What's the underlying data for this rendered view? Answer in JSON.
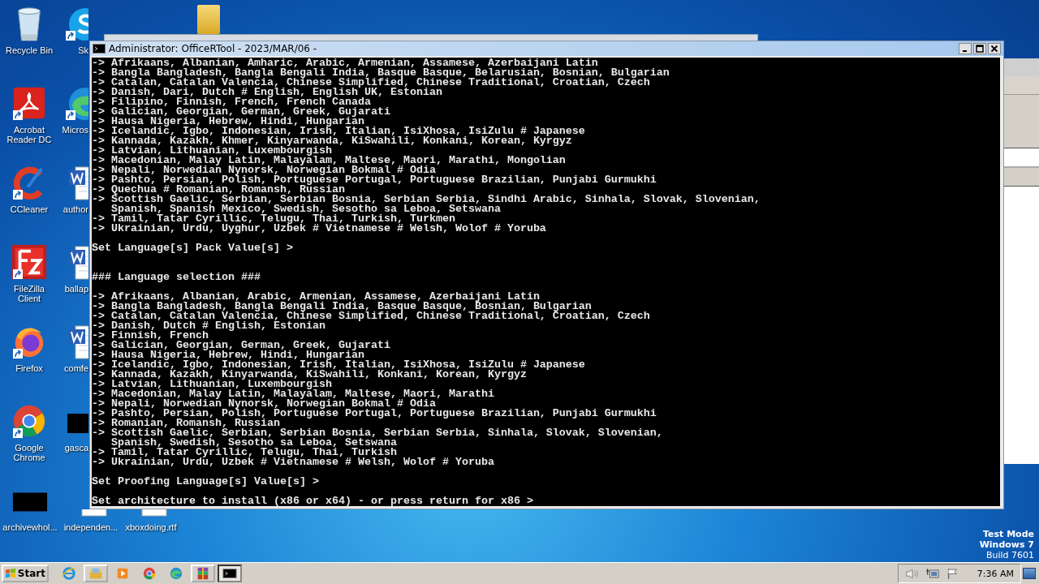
{
  "desktop_icons": [
    {
      "kind": "recycle-bin",
      "label": "Recycle Bin"
    },
    {
      "kind": "skype",
      "label": "Sk"
    },
    {
      "kind": "pdf",
      "label": "Acrobat Reader DC"
    },
    {
      "kind": "edge",
      "label": "Micros"
    },
    {
      "kind": "ccleaner",
      "label": "CCleaner"
    },
    {
      "kind": "word",
      "label": "author"
    },
    {
      "kind": "filezilla",
      "label": "FileZilla Client"
    },
    {
      "kind": "word",
      "label": "ballap"
    },
    {
      "kind": "firefox",
      "label": "Firefox"
    },
    {
      "kind": "word",
      "label": "comfe"
    },
    {
      "kind": "chrome",
      "label": "Google Chrome"
    },
    {
      "kind": "blank",
      "label": "gasca"
    },
    {
      "kind": "blank",
      "label": "archivewhol..."
    },
    {
      "kind": "word",
      "label": "independen..."
    },
    {
      "kind": "word",
      "label": "xboxdoing.rtf"
    }
  ],
  "console": {
    "title": "Administrator: OfficeRTool - 2023/MAR/06 -",
    "blocks": [
      {
        "kind": "list",
        "lines": [
          "-> Afrikaans, Albanian, Amharic, Arabic, Armenian, Assamese, Azerbaijani Latin",
          "-> Bangla Bangladesh, Bangla Bengali India, Basque Basque, Belarusian, Bosnian, Bulgarian",
          "-> Catalan, Catalan Valencia, Chinese Simplified, Chinese Traditional, Croatian, Czech",
          "-> Danish, Dari, Dutch # English, English UK, Estonian",
          "-> Filipino, Finnish, French, French Canada",
          "-> Galician, Georgian, German, Greek, Gujarati",
          "-> Hausa Nigeria, Hebrew, Hindi, Hungarian",
          "-> Icelandic, Igbo, Indonesian, Irish, Italian, IsiXhosa, IsiZulu # Japanese",
          "-> Kannada, Kazakh, Khmer, Kinyarwanda, KiSwahili, Konkani, Korean, Kyrgyz",
          "-> Latvian, Lithuanian, Luxembourgish",
          "-> Macedonian, Malay Latin, Malayalam, Maltese, Maori, Marathi, Mongolian",
          "-> Nepali, Norwedian Nynorsk, Norwegian Bokmal # Odia",
          "-> Pashto, Persian, Polish, Portuguese Portugal, Portuguese Brazilian, Punjabi Gurmukhi",
          "-> Quechua # Romanian, Romansh, Russian",
          "-> Scottish Gaelic, Serbian, Serbian Bosnia, Serbian Serbia, Sindhi Arabic, Sinhala, Slovak, Slovenian,",
          "   Spanish, Spanish Mexico, Swedish, Sesotho sa Leboa, Setswana",
          "-> Tamil, Tatar Cyrillic, Telugu, Thai, Turkish, Turkmen",
          "-> Ukrainian, Urdu, Uyghur, Uzbek # Vietnamese # Welsh, Wolof # Yoruba"
        ]
      },
      {
        "kind": "prompt",
        "lines": [
          "Set Language[s] Pack Value[s] >"
        ]
      },
      {
        "kind": "heading",
        "lines": [
          "### Language selection ###"
        ]
      },
      {
        "kind": "list",
        "lines": [
          "-> Afrikaans, Albanian, Arabic, Armenian, Assamese, Azerbaijani Latin",
          "-> Bangla Bangladesh, Bangla Bengali India, Basque Basque, Bosnian, Bulgarian",
          "-> Catalan, Catalan Valencia, Chinese Simplified, Chinese Traditional, Croatian, Czech",
          "-> Danish, Dutch # English, Estonian",
          "-> Finnish, French",
          "-> Galician, Georgian, German, Greek, Gujarati",
          "-> Hausa Nigeria, Hebrew, Hindi, Hungarian",
          "-> Icelandic, Igbo, Indonesian, Irish, Italian, IsiXhosa, IsiZulu # Japanese",
          "-> Kannada, Kazakh, Kinyarwanda, KiSwahili, Konkani, Korean, Kyrgyz",
          "-> Latvian, Lithuanian, Luxembourgish",
          "-> Macedonian, Malay Latin, Malayalam, Maltese, Maori, Marathi",
          "-> Nepali, Norwedian Nynorsk, Norwegian Bokmal # Odia",
          "-> Pashto, Persian, Polish, Portuguese Portugal, Portuguese Brazilian, Punjabi Gurmukhi",
          "-> Romanian, Romansh, Russian",
          "-> Scottish Gaelic, Serbian, Serbian Bosnia, Serbian Serbia, Sinhala, Slovak, Slovenian,",
          "   Spanish, Swedish, Sesotho sa Leboa, Setswana",
          "-> Tamil, Tatar Cyrillic, Telugu, Thai, Turkish",
          "-> Ukrainian, Urdu, Uzbek # Vietnamese # Welsh, Wolof # Yoruba"
        ]
      },
      {
        "kind": "prompt",
        "lines": [
          "Set Proofing Language[s] Value[s] >"
        ]
      },
      {
        "kind": "prompt",
        "lines": [
          "Set architecture to install (x86 or x64) - or press return for x86 >"
        ]
      }
    ]
  },
  "desktop_notice": [
    "Test Mode",
    "Windows 7",
    "Build 7601"
  ],
  "taskbar": {
    "start": "Start",
    "apps": [
      {
        "kind": "ie",
        "running": false,
        "active": false
      },
      {
        "kind": "explorer",
        "running": true,
        "active": false
      },
      {
        "kind": "media",
        "running": false,
        "active": false
      },
      {
        "kind": "chrome",
        "running": false,
        "active": false
      },
      {
        "kind": "edge",
        "running": false,
        "active": false
      },
      {
        "kind": "archiver",
        "running": true,
        "active": false
      },
      {
        "kind": "console",
        "running": true,
        "active": true
      }
    ],
    "clock": "7:36 AM"
  }
}
